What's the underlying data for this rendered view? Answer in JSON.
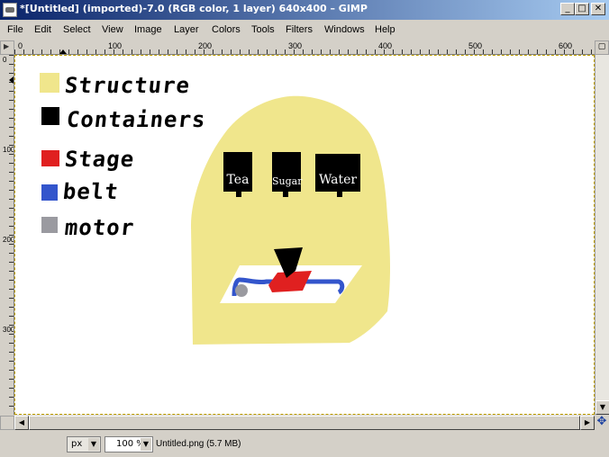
{
  "window": {
    "title": "*[Untitled] (imported)-7.0 (RGB color, 1 layer) 640x400 – GIMP",
    "minimize": "_",
    "maximize": "□",
    "close": "✕"
  },
  "menu": {
    "items": [
      "File",
      "Edit",
      "Select",
      "View",
      "Image",
      "Layer",
      "Colors",
      "Tools",
      "Filters",
      "Windows",
      "Help"
    ]
  },
  "ruler": {
    "h_labels": [
      "0",
      "100",
      "200",
      "300",
      "400",
      "500",
      "600"
    ],
    "v_labels": [
      "0",
      "100",
      "200",
      "300"
    ]
  },
  "drawing": {
    "legend": [
      {
        "label": "Structure",
        "color": "#f0e68c"
      },
      {
        "label": "Containers",
        "color": "#000000"
      },
      {
        "label": "Stage",
        "color": "#e02020"
      },
      {
        "label": "belt",
        "color": "#3355cc"
      },
      {
        "label": "motor",
        "color": "#9a9aa0"
      }
    ],
    "containers": [
      {
        "label": "Tea"
      },
      {
        "label": "Sugar"
      },
      {
        "label": "Water"
      }
    ],
    "colors": {
      "structure": "#f0e68c",
      "stage": "#e02020",
      "belt": "#3355cc",
      "motor": "#9a9aa0"
    }
  },
  "status": {
    "unit": "px",
    "zoom": "100 %",
    "file_info": "Untitled.png (5.7 MB)"
  }
}
